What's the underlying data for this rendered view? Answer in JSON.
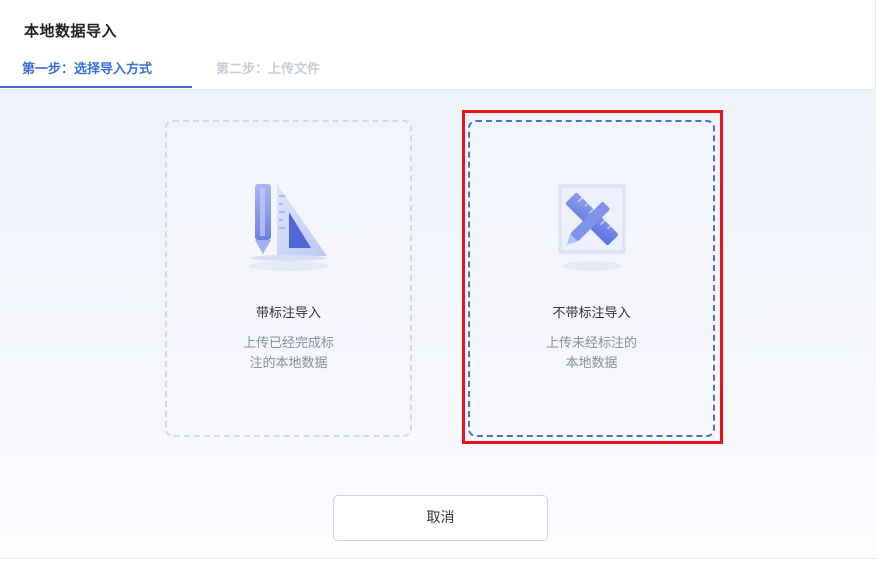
{
  "dialog": {
    "title": "本地数据导入"
  },
  "tabs": [
    {
      "label": "第一步：选择导入方式",
      "active": true
    },
    {
      "label": "第二步：上传文件",
      "active": false
    }
  ],
  "options": [
    {
      "title": "带标注导入",
      "desc_line1": "上传已经完成标",
      "desc_line2": "注的本地数据",
      "icon": "pencil-triangle-ruler-icon"
    },
    {
      "title": "不带标注导入",
      "desc_line1": "上传未经标注的",
      "desc_line2": "本地数据",
      "icon": "crossed-ruler-pencil-icon",
      "selected": true
    }
  ],
  "footer": {
    "cancel_label": "取消"
  },
  "colors": {
    "accent": "#3b6fd8",
    "highlight": "#e5141b"
  }
}
